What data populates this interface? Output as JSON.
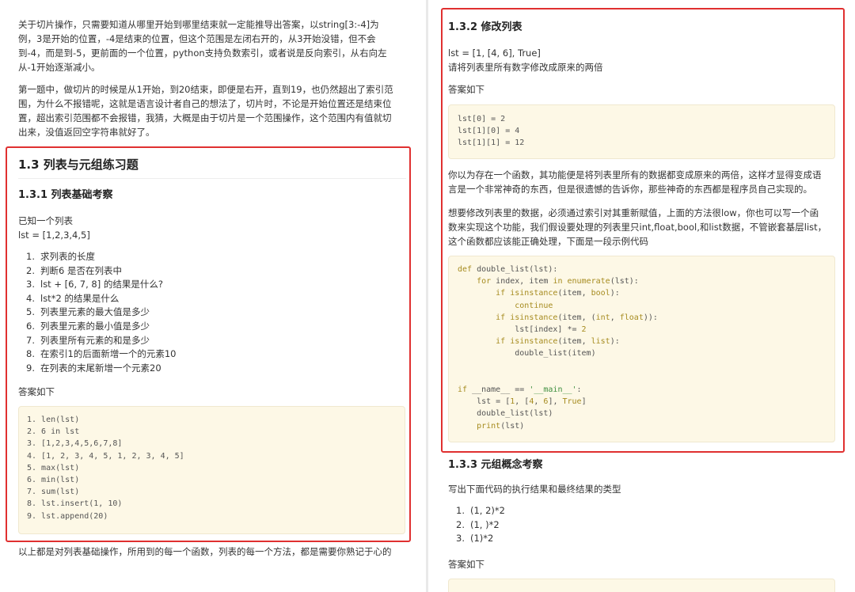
{
  "left": {
    "intro_p1": [
      "关于切片操作，只需要知道从哪里开始到哪里结束就一定能推导出答案，以string[3:-4]为",
      "例，3是开始的位置，-4是结束的位置，但这个范围是左闭右开的，从3开始没错，但不会",
      "到-4，而是到-5，更前面的一个位置，python支持负数索引，或者说是反向索引，从右向左",
      "从-1开始逐渐减小。"
    ],
    "intro_p2": [
      "第一题中，做切片的时候是从1开始，到20结束，即便是右开，直到19，也仍然超出了索引范",
      "围，为什么不报错呢，这就是语言设计者自己的想法了，切片时，不论是开始位置还是结束位",
      "置，超出索引范围都不会报错，我猜，大概是由于切片是一个范围操作，这个范围内有值就切",
      "出来，没值返回空字符串就好了。"
    ],
    "section_title": "1.3 列表与元组练习题",
    "sub_title": "1.3.1 列表基础考察",
    "known": "已知一个列表",
    "lst_def": "lst = [1,2,3,4,5]",
    "questions": [
      "求列表的长度",
      "判断6 是否在列表中",
      "lst + [6, 7, 8] 的结果是什么?",
      "lst*2 的结果是什么",
      "列表里元素的最大值是多少",
      "列表里元素的最小值是多少",
      "列表里所有元素的和是多少",
      "在索引1的后面新增一个的元素10",
      "在列表的末尾新增一个元素20"
    ],
    "answer_label": "答案如下",
    "answers": [
      "1. len(lst)",
      "2. 6 in lst",
      "3. [1,2,3,4,5,6,7,8]",
      "4. [1, 2, 3, 4, 5, 1, 2, 3, 4, 5]",
      "5. max(lst)",
      "6. min(lst)",
      "7. sum(lst)",
      "8. lst.insert(1, 10)",
      "9. lst.append(20)"
    ],
    "closing": "以上都是对列表基础操作，所用到的每一个函数，列表的每一个方法，都是需要你熟记于心的"
  },
  "right": {
    "sub_title": "1.3.2 修改列表",
    "lst_def": "lst = [1, [4, 6], True]",
    "task": "请将列表里所有数字修改成原来的两倍",
    "answer_label": "答案如下",
    "answer_code": [
      "lst[0] = 2",
      "lst[1][0] = 4",
      "lst[1][1] = 12"
    ],
    "para1": [
      "你以为存在一个函数，其功能便是将列表里所有的数据都变成原来的两倍，这样才显得变成语",
      "言是一个非常神奇的东西，但是很遗憾的告诉你，那些神奇的东西都是程序员自己实现的。"
    ],
    "para2": [
      "想要修改列表里的数据，必须通过索引对其重新赋值，上面的方法很low，你也可以写一个函",
      "数来实现这个功能，我们假设要处理的列表里只int,float,bool,和list数据，不管嵌套基层list，",
      "这个函数都应该能正确处理，下面是一段示例代码"
    ],
    "code": {
      "l1a": "def",
      "l1b": " double_list(lst):",
      "l2a": "    for",
      "l2b": " index, item ",
      "l2c": "in",
      "l2d": " ",
      "l2e": "enumerate",
      "l2f": "(lst):",
      "l3a": "        if",
      "l3b": " ",
      "l3c": "isinstance",
      "l3d": "(item, ",
      "l3e": "bool",
      "l3f": "):",
      "l4a": "            continue",
      "l5a": "        if",
      "l5b": " ",
      "l5c": "isinstance",
      "l5d": "(item, (",
      "l5e": "int",
      "l5f": ", ",
      "l5g": "float",
      "l5h": ")):",
      "l6a": "            lst[index] *= ",
      "l6b": "2",
      "l7a": "        if",
      "l7b": " ",
      "l7c": "isinstance",
      "l7d": "(item, ",
      "l7e": "list",
      "l7f": "):",
      "l8a": "            double_list(item)",
      "l11a": "if",
      "l11b": " __name__ == ",
      "l11c": "'__main__'",
      "l11d": ":",
      "l12a": "    lst = [",
      "l12b": "1",
      "l12c": ", [",
      "l12d": "4",
      "l12e": ", ",
      "l12f": "6",
      "l12g": "], ",
      "l12h": "True",
      "l12i": "]",
      "l13a": "    double_list(lst)",
      "l14a": "    ",
      "l14b": "print",
      "l14c": "(lst)"
    },
    "sub_title2": "1.3.3 元组概念考察",
    "tuple_task": "写出下面代码的执行结果和最终结果的类型",
    "tuple_items": [
      "(1, 2)*2",
      "(1, )*2",
      "(1)*2"
    ],
    "answer_label2": "答案如下"
  },
  "colors": {
    "highlight_border": "#e03030",
    "code_bg": "#fdf8e6",
    "keyword": "#a68b1f",
    "string": "#3f8f3f"
  }
}
